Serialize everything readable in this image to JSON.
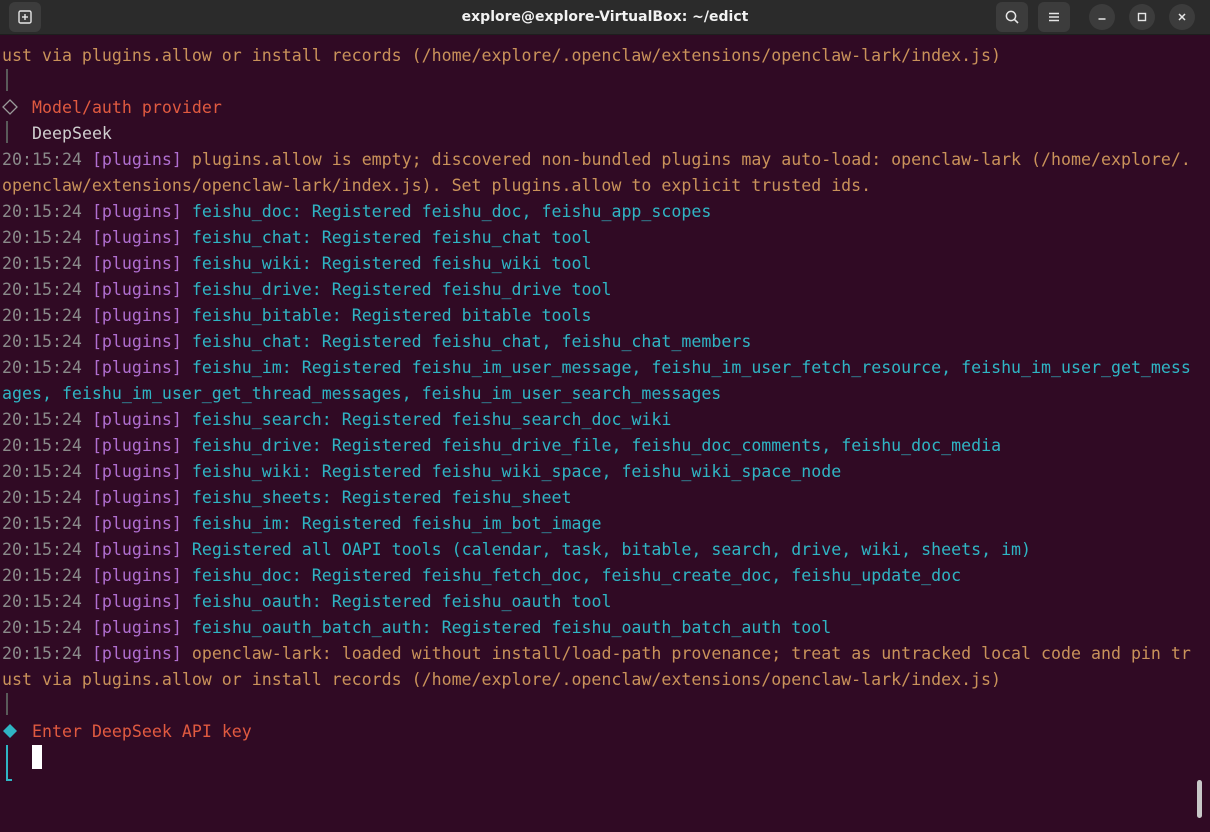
{
  "window": {
    "title": "explore@explore-VirtualBox: ~/edict"
  },
  "toolbar": {
    "new_tab_icon": "new-tab-icon",
    "search_icon": "search-icon",
    "menu_icon": "hamburger-menu-icon",
    "minimize_icon": "minimize-icon",
    "maximize_icon": "maximize-icon",
    "close_icon": "close-icon"
  },
  "colors": {
    "terminal_bg": "#300a24",
    "timestamp": "#8a8a8a",
    "plugin_tag": "#b06fd0",
    "info_text": "#2fb5c4",
    "warn_text": "#c9925a",
    "prompt_text": "#e05a40"
  },
  "terminal": {
    "top_line": "ust via plugins.allow or install records (/home/explore/.openclaw/extensions/openclaw-lark/index.js)",
    "model_auth_label": "Model/auth provider",
    "provider_value": "DeepSeek",
    "log_lines": [
      {
        "ts": "20:15:24",
        "tag": "[plugins]",
        "msg": "plugins.allow is empty; discovered non-bundled plugins may auto-load: openclaw-lark (/home/explore/.",
        "kind": "warn"
      },
      {
        "ts": "",
        "tag": "",
        "msg": "openclaw/extensions/openclaw-lark/index.js). Set plugins.allow to explicit trusted ids.",
        "kind": "warn"
      },
      {
        "ts": "20:15:24",
        "tag": "[plugins]",
        "msg": "feishu_doc: Registered feishu_doc, feishu_app_scopes",
        "kind": "info"
      },
      {
        "ts": "20:15:24",
        "tag": "[plugins]",
        "msg": "feishu_chat: Registered feishu_chat tool",
        "kind": "info"
      },
      {
        "ts": "20:15:24",
        "tag": "[plugins]",
        "msg": "feishu_wiki: Registered feishu_wiki tool",
        "kind": "info"
      },
      {
        "ts": "20:15:24",
        "tag": "[plugins]",
        "msg": "feishu_drive: Registered feishu_drive tool",
        "kind": "info"
      },
      {
        "ts": "20:15:24",
        "tag": "[plugins]",
        "msg": "feishu_bitable: Registered bitable tools",
        "kind": "info"
      },
      {
        "ts": "20:15:24",
        "tag": "[plugins]",
        "msg": "feishu_chat: Registered feishu_chat, feishu_chat_members",
        "kind": "info"
      },
      {
        "ts": "20:15:24",
        "tag": "[plugins]",
        "msg": "feishu_im: Registered feishu_im_user_message, feishu_im_user_fetch_resource, feishu_im_user_get_mess",
        "kind": "info"
      },
      {
        "ts": "",
        "tag": "",
        "msg": "ages, feishu_im_user_get_thread_messages, feishu_im_user_search_messages",
        "kind": "info"
      },
      {
        "ts": "20:15:24",
        "tag": "[plugins]",
        "msg": "feishu_search: Registered feishu_search_doc_wiki",
        "kind": "info"
      },
      {
        "ts": "20:15:24",
        "tag": "[plugins]",
        "msg": "feishu_drive: Registered feishu_drive_file, feishu_doc_comments, feishu_doc_media",
        "kind": "info"
      },
      {
        "ts": "20:15:24",
        "tag": "[plugins]",
        "msg": "feishu_wiki: Registered feishu_wiki_space, feishu_wiki_space_node",
        "kind": "info"
      },
      {
        "ts": "20:15:24",
        "tag": "[plugins]",
        "msg": "feishu_sheets: Registered feishu_sheet",
        "kind": "info"
      },
      {
        "ts": "20:15:24",
        "tag": "[plugins]",
        "msg": "feishu_im: Registered feishu_im_bot_image",
        "kind": "info"
      },
      {
        "ts": "20:15:24",
        "tag": "[plugins]",
        "msg": "Registered all OAPI tools (calendar, task, bitable, search, drive, wiki, sheets, im)",
        "kind": "info"
      },
      {
        "ts": "20:15:24",
        "tag": "[plugins]",
        "msg": "feishu_doc: Registered feishu_fetch_doc, feishu_create_doc, feishu_update_doc",
        "kind": "info"
      },
      {
        "ts": "20:15:24",
        "tag": "[plugins]",
        "msg": "feishu_oauth: Registered feishu_oauth tool",
        "kind": "info"
      },
      {
        "ts": "20:15:24",
        "tag": "[plugins]",
        "msg": "feishu_oauth_batch_auth: Registered feishu_oauth_batch_auth tool",
        "kind": "info"
      },
      {
        "ts": "20:15:24",
        "tag": "[plugins]",
        "msg": "openclaw-lark: loaded without install/load-path provenance; treat as untracked local code and pin tr",
        "kind": "warn"
      },
      {
        "ts": "",
        "tag": "",
        "msg": "ust via plugins.allow or install records (/home/explore/.openclaw/extensions/openclaw-lark/index.js)",
        "kind": "warn"
      }
    ],
    "api_key_prompt": "Enter DeepSeek API key"
  }
}
